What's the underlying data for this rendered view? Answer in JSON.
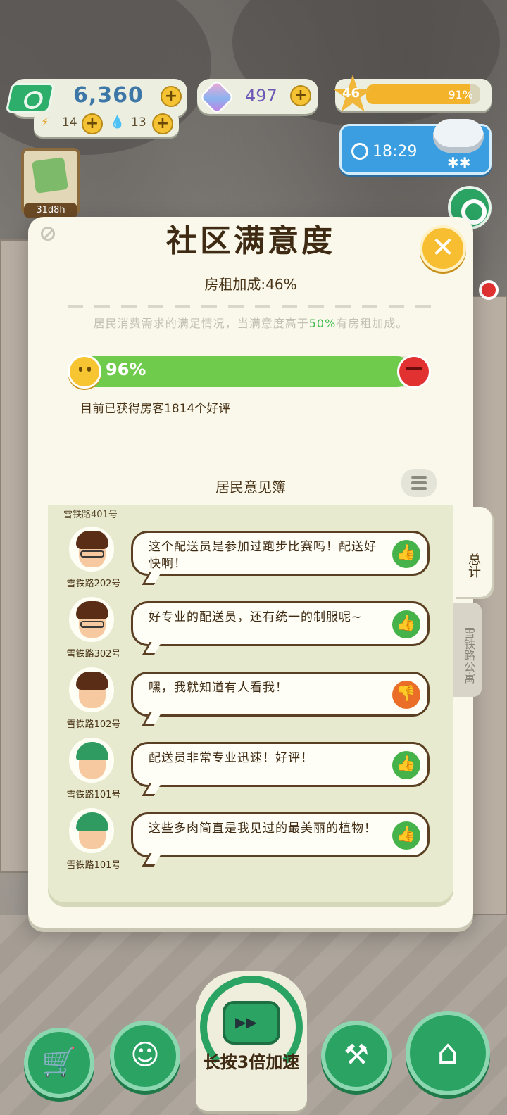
{
  "hud": {
    "money": "6,360",
    "energy": "14",
    "water": "13",
    "gems": "497",
    "level": "46",
    "xp_percent_label": "91%",
    "xp_fraction": 0.91,
    "clock": "18:29",
    "weather": "snow",
    "album_timer": "31d8h",
    "plus_symbol": "+"
  },
  "modal": {
    "title": "社区满意度",
    "rent_bonus": "房租加成:46%",
    "description_pre": "居民消费需求的满足情况，当满意度高于",
    "description_highlight": "50%",
    "description_post": "有房租加成。",
    "satisfaction_label": "96%",
    "satisfaction_fraction": 0.96,
    "reviews_count_text": "目前已获得房客1814个好评",
    "book_title": "居民意见簿",
    "close_symbol": "✕"
  },
  "comments": {
    "clipped_top_address": "雪铁路401号",
    "items": [
      {
        "address": "雪铁路202号",
        "text": "这个配送员是参加过跑步比赛吗！配送好快啊！",
        "rating": "up",
        "avatar": "glasses-curly"
      },
      {
        "address": "雪铁路302号",
        "text": "好专业的配送员，还有统一的制服呢~",
        "rating": "up",
        "avatar": "glasses-curly"
      },
      {
        "address": "雪铁路102号",
        "text": "嘿，我就知道有人看我！",
        "rating": "down",
        "avatar": "curly-brown"
      },
      {
        "address": "雪铁路101号",
        "text": "配送员非常专业迅速！好评！",
        "rating": "up",
        "avatar": "green-cap"
      },
      {
        "address": "雪铁路101号",
        "text": "这些多肉简直是我见过的最美丽的植物！",
        "rating": "up",
        "avatar": "green-cap"
      }
    ]
  },
  "tabs": {
    "total": "总计",
    "apartment": "雪铁路公寓"
  },
  "bottom": {
    "boost_label": "长按3倍加速"
  },
  "colors": {
    "primary_green": "#2aa363",
    "bar_green": "#6fcb4c",
    "accent_yellow": "#f7be32",
    "highlight_green": "#3dbb4a",
    "dislike_orange": "#ea6d28"
  }
}
